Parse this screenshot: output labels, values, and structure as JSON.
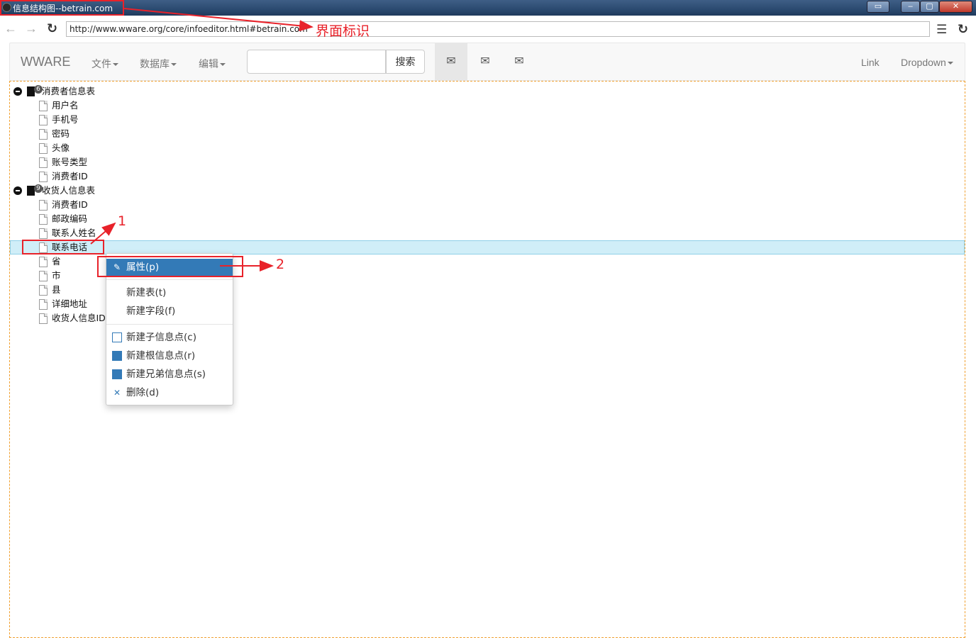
{
  "window": {
    "title": "信息结构图--betrain.com",
    "tray_label": "▭",
    "min_label": "–",
    "max_label": "▢",
    "close_label": "✕"
  },
  "browser": {
    "url": "http://www.wware.org/core/infoeditor.html#betrain.com",
    "back_icon": "arrow-left",
    "forward_icon": "arrow-right",
    "reload_icon": "reload",
    "menu_icon": "hamburger"
  },
  "navbar": {
    "brand": "WWARE",
    "menus": [
      {
        "label": "文件"
      },
      {
        "label": "数据库"
      },
      {
        "label": "编辑"
      }
    ],
    "search_value": "",
    "search_button": "搜索",
    "mail_buttons": [
      {
        "icon": "envelope",
        "active": true
      },
      {
        "icon": "envelope",
        "active": false
      },
      {
        "icon": "envelope",
        "active": false
      }
    ],
    "right_link": "Link",
    "right_dropdown": "Dropdown"
  },
  "tree": {
    "groups": [
      {
        "label": "消费者信息表",
        "count": "6",
        "children": [
          "用户名",
          "手机号",
          "密码",
          "头像",
          "账号类型",
          "消费者ID"
        ]
      },
      {
        "label": "收货人信息表",
        "count": "9",
        "children": [
          "消费者ID",
          "邮政编码",
          "联系人姓名",
          "联系电话",
          "省",
          "市",
          "县",
          "详细地址",
          "收货人信息ID"
        ]
      }
    ],
    "selected": "联系电话"
  },
  "context_menu": {
    "items": [
      {
        "label": "属性(p)",
        "icon": "edit-icon",
        "active": true
      },
      {
        "label": "新建表(t)",
        "icon": "",
        "active": false
      },
      {
        "label": "新建字段(f)",
        "icon": "",
        "active": false
      },
      {
        "label": "新建子信息点(c)",
        "icon": "copy-icon",
        "active": false
      },
      {
        "label": "新建根信息点(r)",
        "icon": "copy-solid-icon",
        "active": false
      },
      {
        "label": "新建兄弟信息点(s)",
        "icon": "copy-solid-icon",
        "active": false
      },
      {
        "label": "删除(d)",
        "icon": "remove-icon",
        "active": false
      }
    ]
  },
  "annotations": {
    "title_label": "界面标识",
    "step1": "1",
    "step2": "2",
    "color": "#e8222a"
  }
}
